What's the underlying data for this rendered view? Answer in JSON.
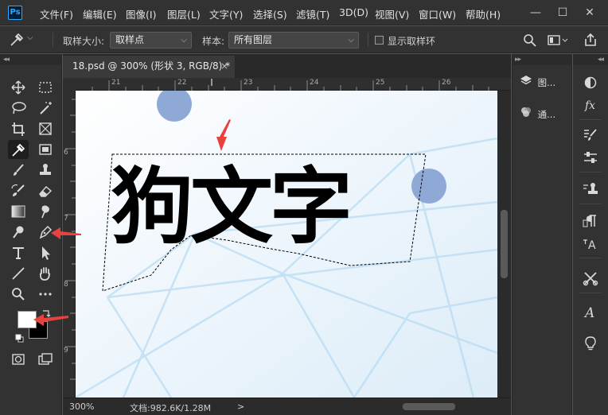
{
  "menubar": {
    "logo": "Ps",
    "items": [
      "文件(F)",
      "编辑(E)",
      "图像(I)",
      "图层(L)",
      "文字(Y)",
      "选择(S)",
      "滤镜(T)",
      "3D(D)",
      "视图(V)",
      "窗口(W)",
      "帮助(H)"
    ],
    "window_buttons": [
      "—",
      "☐",
      "✕"
    ]
  },
  "optionsbar": {
    "sample_size_label": "取样大小:",
    "sample_size_value": "取样点",
    "sample_label": "样本:",
    "sample_value": "所有图层",
    "show_ring_label": "显示取样环",
    "caret": "⌵"
  },
  "collapse": {
    "left": "◂◂",
    "right": "▸▸"
  },
  "document": {
    "tab_title": "18.psd @ 300% (形状 3, RGB/8) *",
    "close": "×",
    "canvas_text": "狗文字"
  },
  "rulers": {
    "h": [
      "21",
      "22",
      "23",
      "24",
      "25",
      "26"
    ],
    "v": [
      "6",
      "7",
      "8",
      "9"
    ]
  },
  "status": {
    "zoom": "300%",
    "doc_info": "文档:982.6K/1.28M",
    "arrow": ">"
  },
  "panels": {
    "layers": "图...",
    "channels": "通..."
  },
  "colors": {
    "accent": "#31a8ff",
    "annotation_arrow": "#e8423f",
    "circle": "#8fa9d6",
    "foreground": "#ffffff",
    "background": "#000000"
  }
}
